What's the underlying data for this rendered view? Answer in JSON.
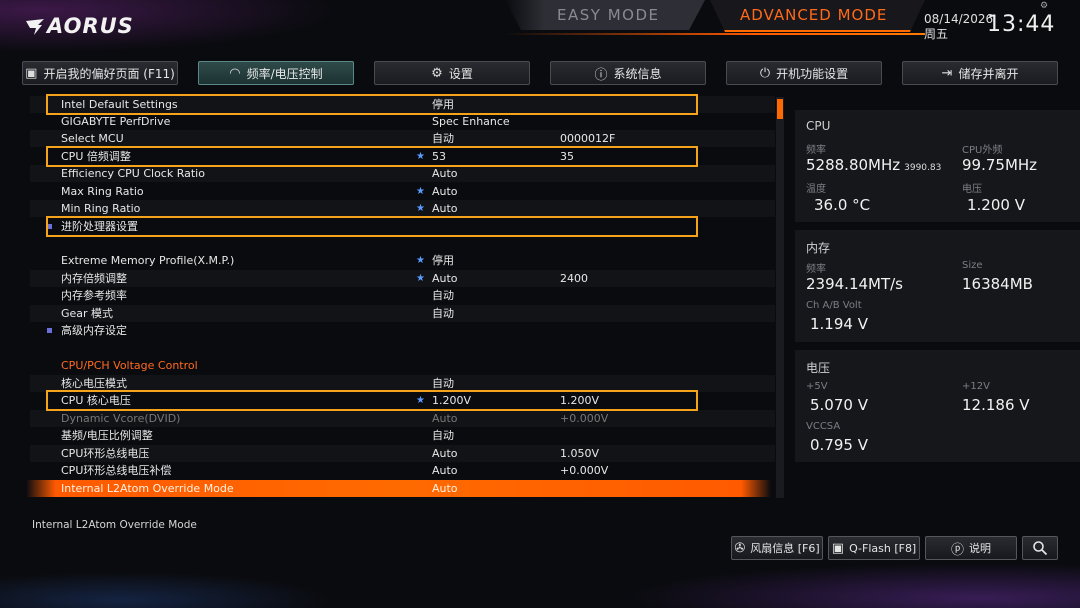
{
  "brand": "AORUS",
  "modes": {
    "easy": "EASY MODE",
    "advanced": "ADVANCED MODE"
  },
  "datetime": {
    "date": "08/14/2026",
    "weekday": "周五",
    "time": "13:44"
  },
  "tabs": [
    {
      "label": "开启我的偏好页面 (F11)",
      "icon": "favorites-icon"
    },
    {
      "label": "频率/电压控制",
      "icon": "gauge-icon"
    },
    {
      "label": "设置",
      "icon": "gear-icon"
    },
    {
      "label": "系统信息",
      "icon": "info-icon"
    },
    {
      "label": "开机功能设置",
      "icon": "power-icon"
    },
    {
      "label": "储存并离开",
      "icon": "exit-icon"
    }
  ],
  "rows": [
    {
      "label": "Intel Default Settings",
      "value": "停用",
      "value2": ""
    },
    {
      "label": "GIGABYTE PerfDrive",
      "value": "Spec Enhance",
      "value2": ""
    },
    {
      "label": "Select MCU",
      "value": "自动",
      "value2": "0000012F"
    },
    {
      "label": "CPU 倍频调整",
      "value": "53",
      "value2": "35"
    },
    {
      "label": "Efficiency CPU Clock Ratio",
      "value": "Auto",
      "value2": ""
    },
    {
      "label": "Max Ring Ratio",
      "value": "Auto",
      "value2": ""
    },
    {
      "label": "Min Ring Ratio",
      "value": "Auto",
      "value2": ""
    },
    {
      "label": "进阶处理器设置",
      "value": "",
      "value2": ""
    },
    {
      "label": "Extreme Memory Profile(X.M.P.)",
      "value": "停用",
      "value2": ""
    },
    {
      "label": "内存倍频调整",
      "value": "Auto",
      "value2": "2400"
    },
    {
      "label": "内存参考频率",
      "value": "自动",
      "value2": ""
    },
    {
      "label": "Gear 模式",
      "value": "自动",
      "value2": ""
    },
    {
      "label": "高级内存设定",
      "value": "",
      "value2": ""
    },
    {
      "label": "CPU/PCH Voltage Control",
      "value": "",
      "value2": ""
    },
    {
      "label": "核心电压模式",
      "value": "自动",
      "value2": ""
    },
    {
      "label": "CPU 核心电压",
      "value": "1.200V",
      "value2": "1.200V"
    },
    {
      "label": "Dynamic Vcore(DVID)",
      "value": "Auto",
      "value2": "+0.000V"
    },
    {
      "label": "基频/电压比例调整",
      "value": "自动",
      "value2": ""
    },
    {
      "label": "CPU环形总线电压",
      "value": "Auto",
      "value2": "1.050V"
    },
    {
      "label": "CPU环形总线电压补偿",
      "value": "Auto",
      "value2": "+0.000V"
    },
    {
      "label": "Internal L2Atom Override Mode",
      "value": "Auto",
      "value2": ""
    }
  ],
  "info": {
    "cpu": {
      "title": "CPU",
      "freq_label": "频率",
      "freq_value": "5288.80MHz",
      "freq_sub": "3990.83",
      "bclk_label": "CPU外频",
      "bclk_value": "99.75MHz",
      "temp_label": "温度",
      "temp_value": "36.0 °C",
      "volt_label": "电压",
      "volt_value": "1.200 V"
    },
    "memory": {
      "title": "内存",
      "freq_label": "频率",
      "freq_value": "2394.14MT/s",
      "size_label": "Size",
      "size_value": "16384MB",
      "volt_label": "Ch A/B Volt",
      "volt_value": "1.194 V"
    },
    "voltage": {
      "title": "电压",
      "v5_label": "+5V",
      "v5_value": "5.070 V",
      "v12_label": "+12V",
      "v12_value": "12.186 V",
      "vccsa_label": "VCCSA",
      "vccsa_value": "0.795 V"
    }
  },
  "status_text": "Internal L2Atom Override Mode",
  "bottom_buttons": {
    "fan": "风扇信息 [F6]",
    "qflash": "Q-Flash [F8]",
    "help": "说明",
    "search_icon": "search-icon"
  },
  "colors": {
    "accent": "#ff6a00",
    "highlight_box": "#f5a31a",
    "section": "#ff6a20"
  }
}
